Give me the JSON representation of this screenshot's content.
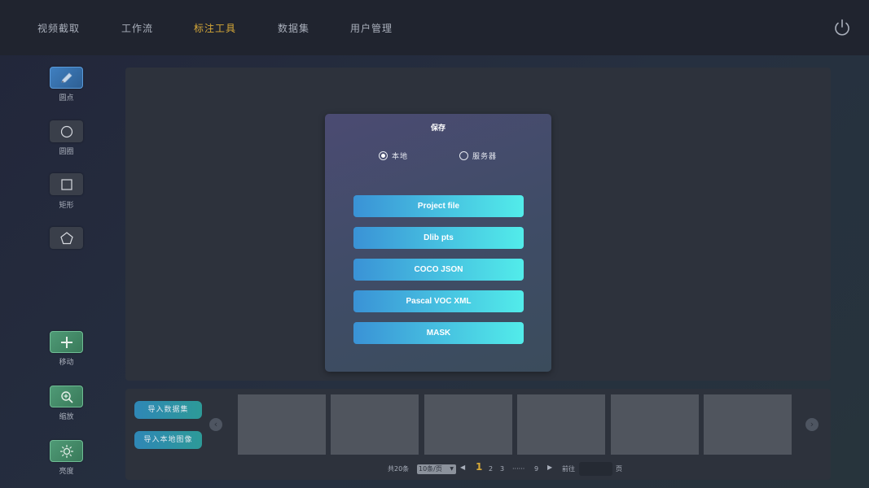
{
  "nav": {
    "items": [
      {
        "label": "视频截取"
      },
      {
        "label": "工作流"
      },
      {
        "label": "标注工具"
      },
      {
        "label": "数据集"
      },
      {
        "label": "用户管理"
      }
    ],
    "active_index": 2,
    "power_icon": "power-icon"
  },
  "toolbar": {
    "tools": [
      {
        "label": "圆点",
        "icon": "pen-icon"
      },
      {
        "label": "圆圈",
        "icon": "circle-icon"
      },
      {
        "label": "矩形",
        "icon": "square-icon"
      },
      {
        "label": "",
        "icon": "pentagon-icon"
      },
      {
        "label": "移动",
        "icon": "plus-icon"
      },
      {
        "label": "缩放",
        "icon": "zoom-in-icon"
      },
      {
        "label": "亮度",
        "icon": "brightness-icon"
      }
    ]
  },
  "dialog": {
    "title": "保存",
    "options": [
      {
        "label": "本地",
        "selected": true
      },
      {
        "label": "服务器",
        "selected": false
      }
    ],
    "buttons": [
      {
        "label": "Project file"
      },
      {
        "label": "Dlib pts"
      },
      {
        "label": "COCO JSON"
      },
      {
        "label": "Pascal VOC XML"
      },
      {
        "label": "MASK"
      }
    ]
  },
  "bottom": {
    "import_dataset_label": "导入数据集",
    "import_local_label": "导入本地图像",
    "prev_icon": "chevron-left-icon",
    "next_icon": "chevron-right-icon",
    "thumbnail_count": 6
  },
  "pagination": {
    "total_label": "共20条",
    "page_size_label": "10条/页",
    "pages": [
      "1",
      "2",
      "3"
    ],
    "ellipsis": "······",
    "last_page": "9",
    "current_page": "1",
    "goto_label": "前往",
    "page_suffix": "页"
  },
  "colors": {
    "accent": "#d7a938",
    "button_gradient_start": "#3a92d6",
    "button_gradient_end": "#52ecea"
  }
}
